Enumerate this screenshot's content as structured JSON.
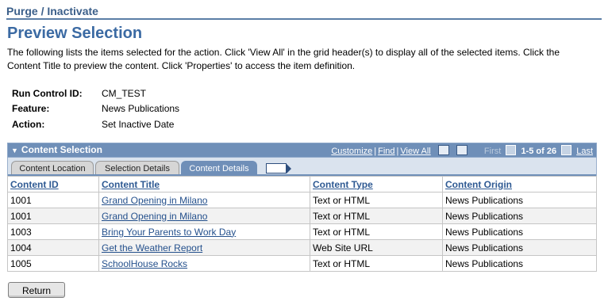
{
  "breadcrumb": "Purge / Inactivate",
  "page_title": "Preview Selection",
  "instructions": "The following lists the items selected for the action.  Click 'View All' in the grid header(s) to display all of the selected items.  Click the Content Title to preview the content.  Click 'Properties' to access the item definition.",
  "fields": {
    "run_control": {
      "label": "Run Control ID:",
      "value": "CM_TEST"
    },
    "feature": {
      "label": "Feature:",
      "value": "News Publications"
    },
    "action": {
      "label": "Action:",
      "value": "Set Inactive Date"
    }
  },
  "grid": {
    "title": "Content Selection",
    "nav": {
      "customize": "Customize",
      "find": "Find",
      "view_all": "View All",
      "first": "First",
      "range": "1-5 of 26",
      "last": "Last"
    },
    "tabs": [
      "Content Location",
      "Selection Details",
      "Content Details"
    ],
    "active_tab": "Content Details",
    "columns": [
      "Content ID",
      "Content Title",
      "Content Type",
      "Content Origin"
    ],
    "rows": [
      {
        "id": "1001",
        "title": "Grand Opening in Milano",
        "type": "Text or HTML",
        "origin": "News Publications"
      },
      {
        "id": "1001",
        "title": "Grand Opening in Milano",
        "type": "Text or HTML",
        "origin": "News Publications"
      },
      {
        "id": "1003",
        "title": "Bring Your Parents to Work Day",
        "type": "Text or HTML",
        "origin": "News Publications"
      },
      {
        "id": "1004",
        "title": "Get the Weather Report",
        "type": "Web Site URL",
        "origin": "News Publications"
      },
      {
        "id": "1005",
        "title": "SchoolHouse Rocks",
        "type": "Text or HTML",
        "origin": "News Publications"
      }
    ]
  },
  "buttons": {
    "return": "Return"
  },
  "colors": {
    "header_blue": "#6f8fb8",
    "title_blue": "#3b6aa3",
    "link_blue": "#24508c"
  }
}
